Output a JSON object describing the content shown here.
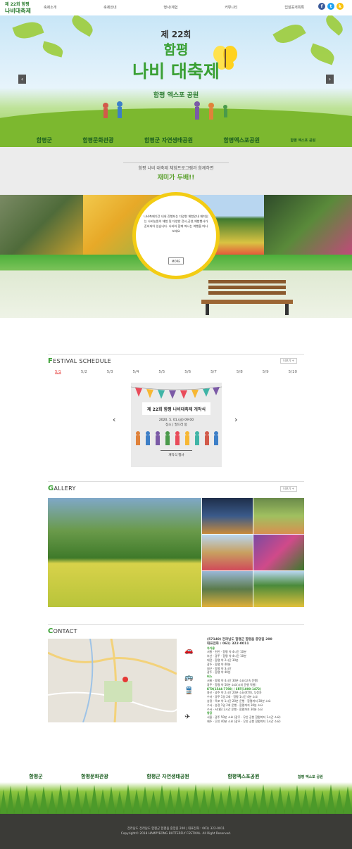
{
  "header": {
    "logo_line1": "제 22회 함평",
    "logo_line2": "나비대축제",
    "nav": [
      "축제소개",
      "축제안내",
      "행사/체험",
      "커뮤니티",
      "입찰공개목록"
    ],
    "sns": [
      {
        "icon": "facebook-icon",
        "glyph": "f",
        "color": "#3b5998"
      },
      {
        "icon": "twitter-icon",
        "glyph": "t",
        "color": "#1da1f2"
      },
      {
        "icon": "kakaostory-icon",
        "glyph": "k",
        "color": "#f9c20a"
      }
    ]
  },
  "hero": {
    "edition": "제 22회",
    "city": "함평",
    "festival": "나비 대축제",
    "venue": "함평 엑스포 공원",
    "sponsors": [
      "함평군",
      "함평문화관광",
      "함평군 자연생태공원",
      "함평엑스포공원",
      "함평 엑스포 공원"
    ]
  },
  "intro": {
    "line1": "함평 나비 대축제 체험프로그램과 함께하면",
    "line2": "재미가 두배!!"
  },
  "program_circle": {
    "text": "나비축제기간 내내 진행되는 다양한 체험안내 재미있는 나비농원의 체험 및 다양한 전시,공연,체험행사가 준비되어 있습니다. 나비와 함께 떠나는 여행을 떠나보세요",
    "more": "MORE"
  },
  "schedule": {
    "title_initial": "F",
    "title_rest": "ESTIVAL SCHEDULE",
    "more": "더보기 +",
    "dates": [
      "5/1",
      "5/2",
      "5/3",
      "5/4",
      "5/5",
      "5/6",
      "5/7",
      "5/8",
      "5/9",
      "5/10"
    ],
    "active_date": "5/1",
    "event_title": "제 22회 함평 나비대축제 개막식",
    "event_time": "2020. 5. 01.(금) 09:00",
    "event_place": "장소 | 필드러 봉",
    "event_label": "개막식 행사"
  },
  "gallery": {
    "title_initial": "G",
    "title_rest": "ALLERY",
    "more": "더보기 +"
  },
  "contact": {
    "title_initial": "C",
    "title_rest": "ONTACT",
    "address": "(57149) 전라남도 함평군 함평읍 중앙길 200",
    "phone": "대표전화 : 061) 322-0011",
    "car_head": "자가용",
    "car_lines": [
      "서울 · 천안 · 함평 약 4시간 10분",
      "부산 · 광주 · 함평 약 4시간 10분",
      "대전 · 함평 약 2시간 30분",
      "광주 · 함평 약 40분",
      "대구 · 함평 약 3시간",
      "광주 · 함평 약 40분"
    ],
    "bus_head": "버스",
    "bus_lines": [
      "서울 · 함평 약 4시간 30분 소요(고속 운행)",
      "광주 · 함평 약 50분 소요(시외 운행 직행)"
    ],
    "train_head": "KTX(1544-7788) / SRT(1800-1472)",
    "train_lines": [
      "용산 · 광주 약 2시간 20분 소요(KTX), 무정차",
      "수서 · 광주 1일 2회 · 함평 1시간 4분 소요",
      "송정 · 목포 약 1시간 20분 운행 · 함평까지 30분 소요",
      "수서 · 송정 1일 2회 운행 · 함평까지 30분 소요",
      "수서 · 서대전 2시간 운행 · 함평까지 30분 소요"
    ],
    "air_head": "항공",
    "air_lines": [
      "서울 · 광주 50분 소요 (광주 · 무안 공항 함평까지 1시간 소요)",
      "제주 · 무안 40분 소요 (광주 · 무안 공항 함평까지 1시간 소요)"
    ]
  },
  "footer": {
    "logos": [
      "함평군",
      "함평문화관광",
      "함평군 자연생태공원",
      "함평엑스포공원",
      "함평 엑스포 공원"
    ],
    "line1": "전라남도 전라남도 함평군 함평읍 중앙길 200 | 대표전화 : 061) 322-0011",
    "line2": "Copyright© 2018 HAMPYEONG BUTTERFLY FESTIVAL. All Right Reserved."
  }
}
